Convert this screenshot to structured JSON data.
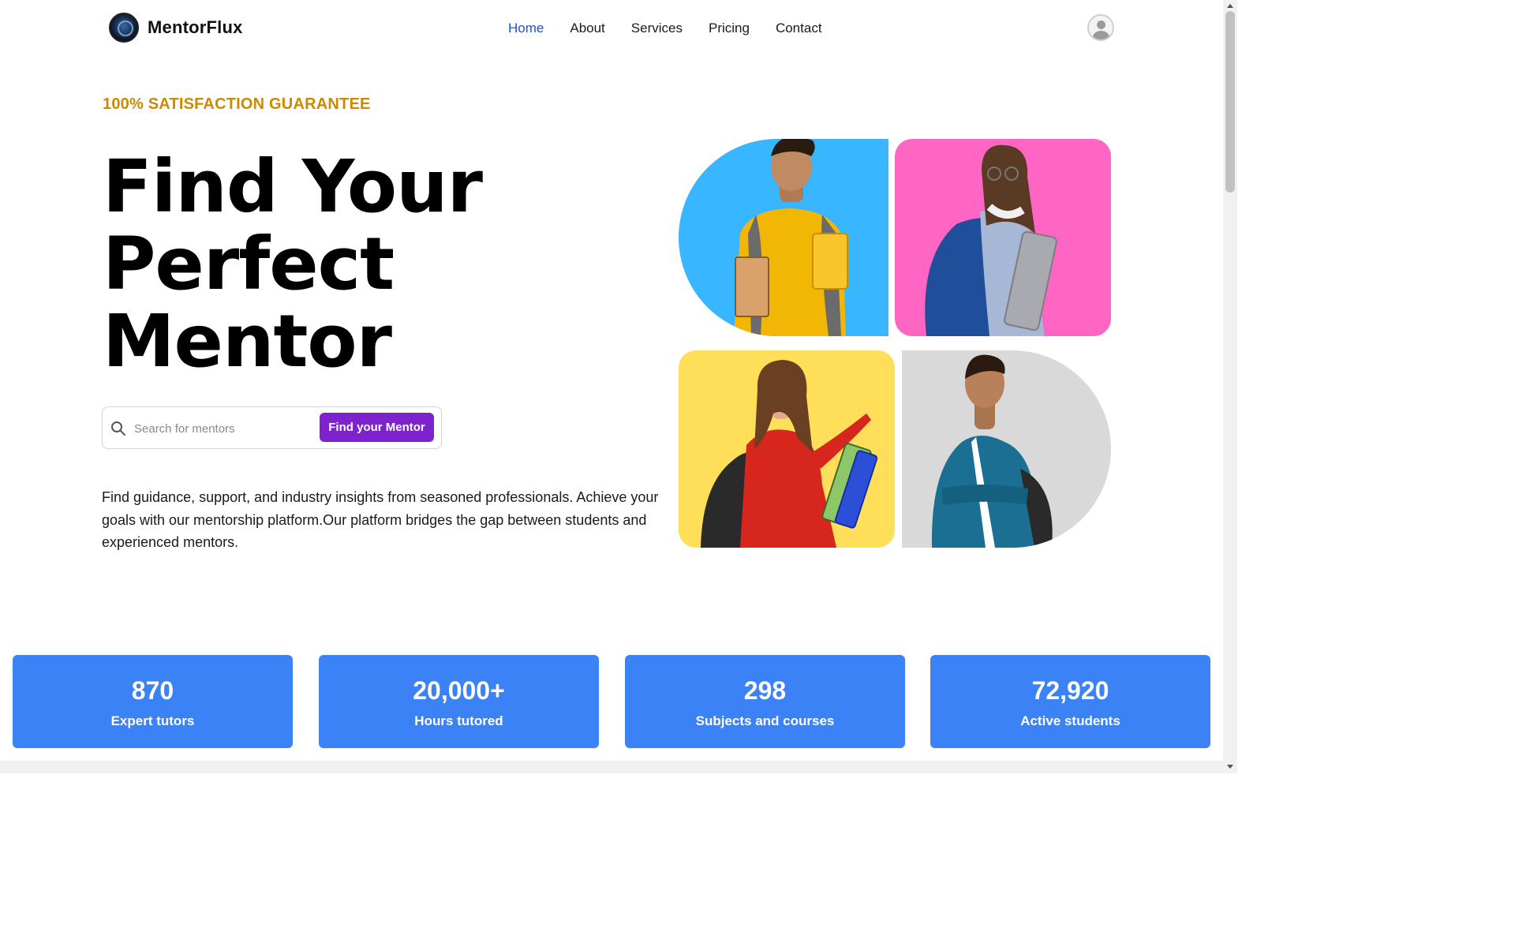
{
  "brand": {
    "name": "MentorFlux",
    "logo_icon": "mentor-logo-icon"
  },
  "nav": {
    "items": [
      {
        "label": "Home",
        "active": true
      },
      {
        "label": "About",
        "active": false
      },
      {
        "label": "Services",
        "active": false
      },
      {
        "label": "Pricing",
        "active": false
      },
      {
        "label": "Contact",
        "active": false
      }
    ],
    "avatar_icon": "user-avatar-icon",
    "active_color": "#1d4ed8"
  },
  "hero": {
    "eyebrow": "100% SATISFACTION GUARANTEE",
    "title_lines": [
      "Find Your",
      "Perfect",
      "Mentor"
    ],
    "search": {
      "placeholder": "Search for mentors",
      "value": "",
      "button_label": "Find your Mentor",
      "icon": "search-icon"
    },
    "description": "Find guidance, support, and industry insights from seasoned professionals. Achieve your goals with our mentorship platform.Our platform bridges the gap between students and experienced mentors."
  },
  "gallery": [
    {
      "bg": "#38b6ff",
      "subject": "student-with-books-photo"
    },
    {
      "bg": "#ff66c4",
      "subject": "student-with-laptop-photo"
    },
    {
      "bg": "#ffde59",
      "subject": "student-pointing-photo"
    },
    {
      "bg": "#d9d9d9",
      "subject": "student-arms-crossed-photo"
    }
  ],
  "stats": [
    {
      "value": "870",
      "label": "Expert tutors"
    },
    {
      "value": "20,000+",
      "label": "Hours tutored"
    },
    {
      "value": "298",
      "label": "Subjects and courses"
    },
    {
      "value": "72,920",
      "label": "Active students"
    }
  ],
  "colors": {
    "accent_gold": "#ca8a04",
    "primary_purple": "#7e22ce",
    "stat_blue": "#3b82f6"
  }
}
